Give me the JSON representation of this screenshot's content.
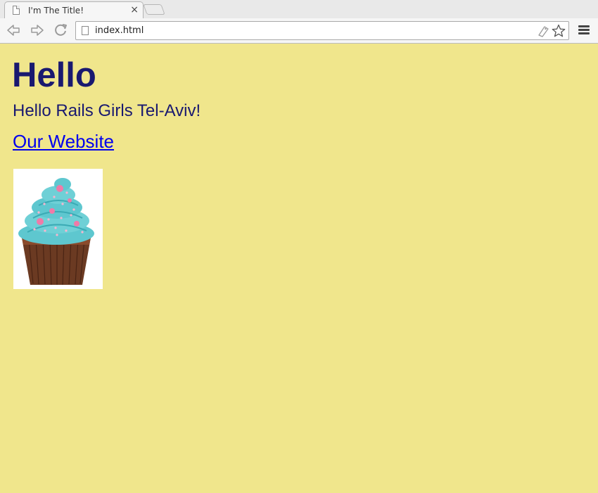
{
  "browser": {
    "tab_title": "I'm The Title!",
    "tab_close_glyph": "×",
    "url": "index.html",
    "icons": [
      "page-icon",
      "close-icon",
      "new-tab-icon",
      "back-icon",
      "forward-icon",
      "reload-icon",
      "tag-icon",
      "star-icon",
      "menu-icon"
    ]
  },
  "page": {
    "background_color": "#f0e68c",
    "text_color": "#191970",
    "link_color": "#0000ee",
    "heading": "Hello",
    "intro": "Hello Rails Girls Tel-Aviv!",
    "link_text": "Our Website",
    "image": "cupcake"
  }
}
